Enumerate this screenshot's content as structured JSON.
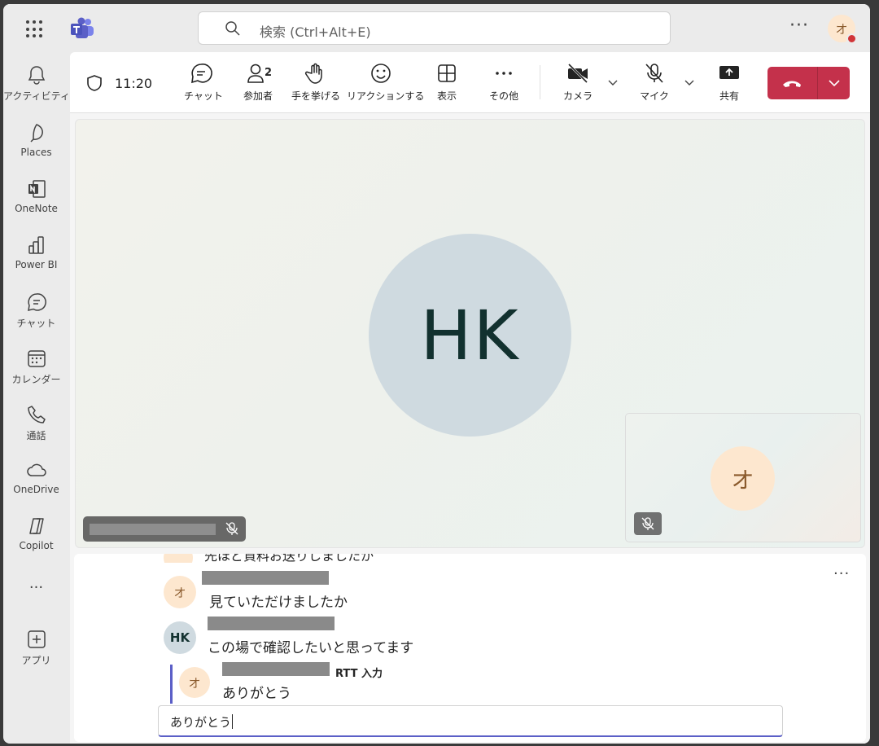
{
  "search": {
    "placeholder": "検索 (Ctrl+Alt+E)"
  },
  "topbar": {
    "more": "···",
    "avatar_initial": "オ"
  },
  "rail": {
    "items": [
      {
        "label": "アクティビティ"
      },
      {
        "label": "Places"
      },
      {
        "label": "OneNote"
      },
      {
        "label": "Power BI"
      },
      {
        "label": "チャット"
      },
      {
        "label": "カレンダー"
      },
      {
        "label": "通話"
      },
      {
        "label": "OneDrive"
      },
      {
        "label": "Copilot"
      },
      {
        "label": "···"
      },
      {
        "label": "アプリ"
      }
    ]
  },
  "toolbar": {
    "time": "11:20",
    "chat": "チャット",
    "participants": "参加者",
    "participant_count": "2",
    "raise_hand": "手を挙げる",
    "react": "リアクションする",
    "view": "表示",
    "more": "その他",
    "camera": "カメラ",
    "mic": "マイク",
    "share": "共有"
  },
  "stage": {
    "main_initials": "HK",
    "self_initial": "オ"
  },
  "rtt": {
    "more": "···",
    "messages": [
      {
        "initials": "オ",
        "text": "先ほど資料お送りしましたか"
      },
      {
        "initials": "オ",
        "text": "見ていただけましたか"
      },
      {
        "initials": "HK",
        "text": "この場で確認したいと思ってます"
      },
      {
        "initials": "オ",
        "text": "ありがとう",
        "label": "RTT 入力"
      }
    ],
    "input_value": "ありがとう"
  },
  "colors": {
    "accent": "#5b5fc7",
    "leave": "#c4314b",
    "avatar_o_bg": "#fde7cf",
    "avatar_hk_bg": "#cfdae0"
  }
}
